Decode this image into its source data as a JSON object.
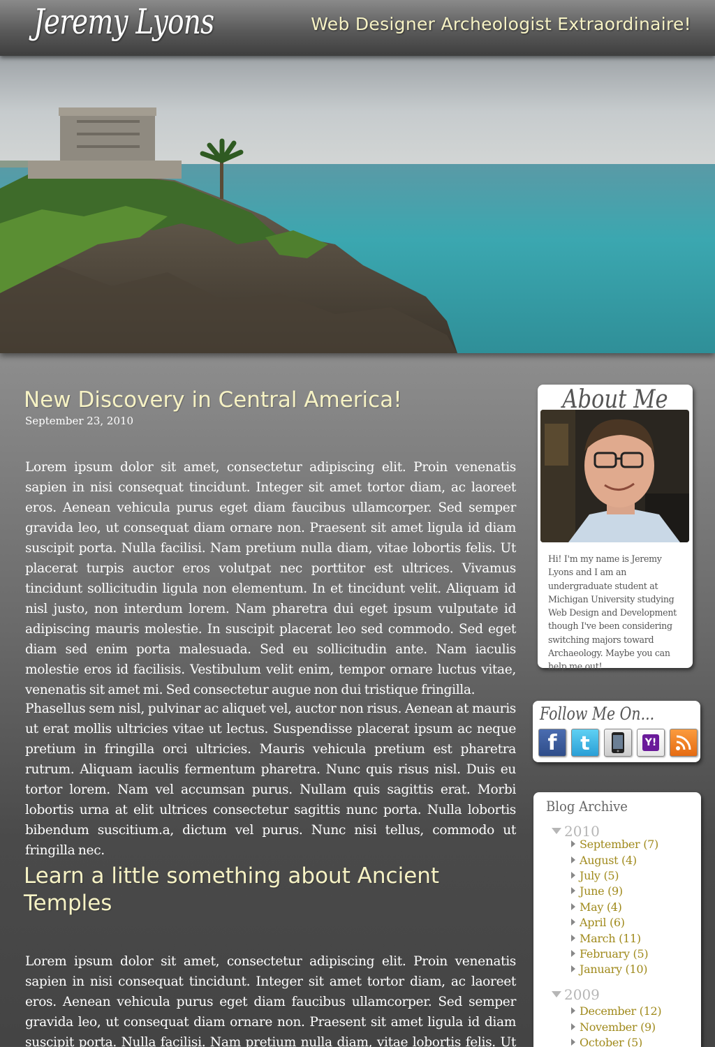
{
  "header": {
    "site_title": "Jeremy Lyons",
    "tagline": "Web Designer Archeologist Extraordinaire!"
  },
  "hero": {
    "image": "coastal-ruins-temple-photo"
  },
  "posts": [
    {
      "title": "New Discovery in Central America!",
      "date": "September 23, 2010",
      "paragraphs": [
        "Lorem ipsum dolor sit amet, consectetur adipiscing elit. Proin venenatis sapien in nisi consequat tincidunt. Integer sit amet tortor diam, ac laoreet eros. Aenean vehicula purus eget diam faucibus ullamcorper. Sed semper gravida leo, ut consequat diam ornare non. Praesent sit amet ligula id diam suscipit porta. Nulla facilisi. Nam pretium nulla diam, vitae lobortis felis. Ut placerat turpis auctor eros volutpat nec porttitor est ultrices. Vivamus tincidunt sollicitudin ligula non elementum. In et tincidunt velit. Aliquam id nisl justo, non interdum lorem. Nam pharetra dui eget ipsum vulputate id adipiscing mauris molestie. In suscipit placerat leo sed commodo. Sed eget diam sed enim porta malesuada. Sed eu sollicitudin ante. Nam iaculis molestie eros id facilisis. Vestibulum velit enim, tempor ornare luctus vitae, venenatis sit amet mi. Sed consectetur augue non dui tristique fringilla.",
        "Phasellus sem nisl, pulvinar ac aliquet vel, auctor non risus. Aenean at mauris ut erat mollis ultricies vitae ut lectus. Suspendisse placerat ipsum ac neque pretium in fringilla orci ultricies. Mauris vehicula pretium est pharetra rutrum. Aliquam iaculis fermentum pharetra. Nunc quis risus nisl. Duis eu tortor lorem. Nam vel accumsan purus. Nullam quis sagittis erat. Morbi lobortis urna at elit ultrices consectetur sagittis nunc porta. Nulla lobortis bibendum suscitium.a, dictum vel purus. Nunc nisi tellus, commodo ut fringilla nec."
      ]
    },
    {
      "title": "Learn a little something about Ancient Temples",
      "paragraphs": [
        "Lorem ipsum dolor sit amet, consectetur adipiscing elit. Proin venenatis sapien in nisi consequat tincidunt. Integer sit amet tortor diam, ac laoreet eros. Aenean vehicula purus eget diam faucibus ullamcorper. Sed semper gravida leo, ut consequat diam ornare non. Praesent sit amet ligula id diam suscipit porta. Nulla facilisi. Nam pretium nulla diam, vitae lobortis felis. Ut placerat turpis auctor eros volutpat nec porttitor est ultrices."
      ]
    }
  ],
  "sidebar": {
    "about": {
      "title": "About Me",
      "text": "Hi! I'm my name is Jeremy Lyons and I am an undergraduate student at Michigan University studying Web Design and Development though I've been considering switching majors toward Archaeology. Maybe you can help me out!"
    },
    "follow": {
      "title": "Follow Me On...",
      "icons": [
        "facebook-icon",
        "twitter-icon",
        "phone-icon",
        "yahoo-icon",
        "rss-icon"
      ],
      "yahoo_label": "Y!"
    },
    "archive": {
      "title": "Blog Archive",
      "years": [
        {
          "year": "2010",
          "months": [
            {
              "name": "September",
              "count": "(7)"
            },
            {
              "name": "August",
              "count": "(4)"
            },
            {
              "name": "July",
              "count": "(5)"
            },
            {
              "name": "June",
              "count": "(9)"
            },
            {
              "name": "May",
              "count": "(4)"
            },
            {
              "name": "April",
              "count": "(6)"
            },
            {
              "name": "March",
              "count": "(11)"
            },
            {
              "name": "February",
              "count": "(5)"
            },
            {
              "name": "January",
              "count": "(10)"
            }
          ]
        },
        {
          "year": "2009",
          "months": [
            {
              "name": "December",
              "count": "(12)"
            },
            {
              "name": "November",
              "count": "(9)"
            },
            {
              "name": "October",
              "count": "(5)"
            }
          ]
        }
      ]
    }
  },
  "colors": {
    "title_accent": "#f6f2c4",
    "archive_link": "#a08a1c",
    "archive_year": "#b6b6b6"
  }
}
